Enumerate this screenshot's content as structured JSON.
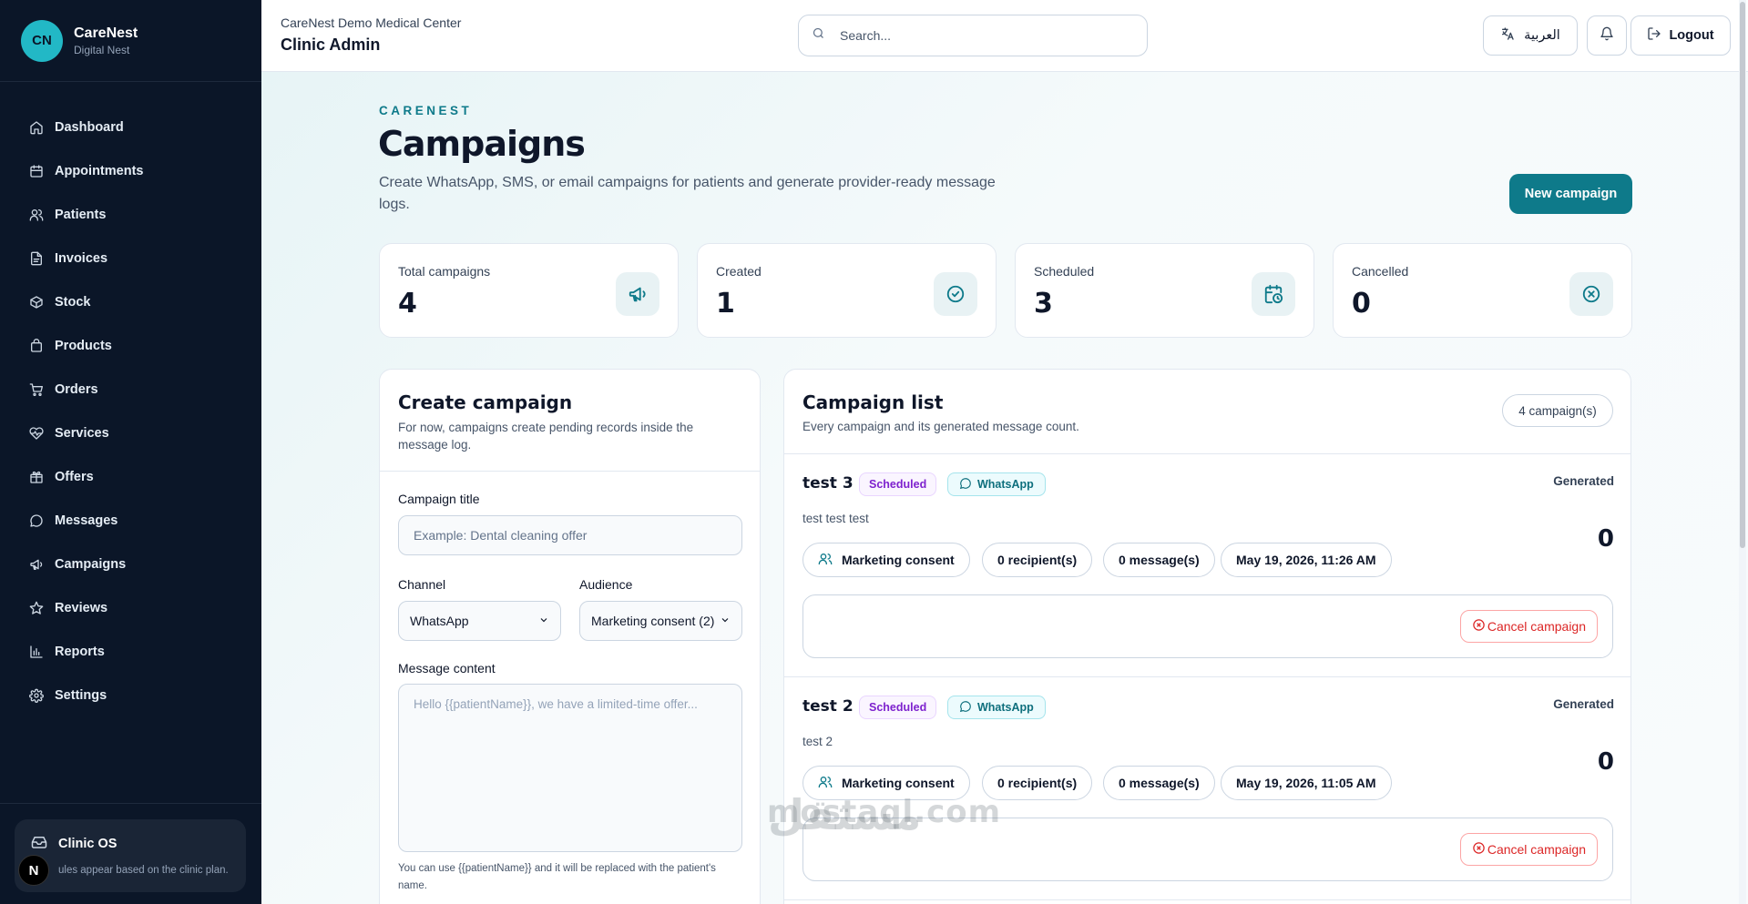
{
  "brand": {
    "initials": "CN",
    "name": "CareNest",
    "sub": "Digital Nest"
  },
  "sidebar": {
    "items": [
      {
        "label": "Dashboard",
        "icon": "home-icon"
      },
      {
        "label": "Appointments",
        "icon": "calendar-icon"
      },
      {
        "label": "Patients",
        "icon": "users-icon"
      },
      {
        "label": "Invoices",
        "icon": "file-icon"
      },
      {
        "label": "Stock",
        "icon": "box-icon"
      },
      {
        "label": "Products",
        "icon": "bag-icon"
      },
      {
        "label": "Orders",
        "icon": "cart-icon"
      },
      {
        "label": "Services",
        "icon": "heart-icon"
      },
      {
        "label": "Offers",
        "icon": "gift-icon"
      },
      {
        "label": "Messages",
        "icon": "chat-icon"
      },
      {
        "label": "Campaigns",
        "icon": "megaphone-icon"
      },
      {
        "label": "Reviews",
        "icon": "star-icon"
      },
      {
        "label": "Reports",
        "icon": "chart-icon"
      },
      {
        "label": "Settings",
        "icon": "gear-icon"
      }
    ],
    "clinic_card": {
      "title": "Clinic OS",
      "text": "ules appear based on the clinic plan."
    },
    "avatar_letter": "N"
  },
  "header": {
    "org": "CareNest Demo Medical Center",
    "role": "Clinic Admin",
    "search_placeholder": "Search...",
    "lang_label": "العربية",
    "logout_label": "Logout"
  },
  "page": {
    "eyebrow": "CARENEST",
    "title": "Campaigns",
    "subtitle": "Create WhatsApp, SMS, or email campaigns for patients and generate provider-ready message logs.",
    "new_button": "New campaign"
  },
  "stats": [
    {
      "label": "Total campaigns",
      "value": "4",
      "icon": "megaphone-icon"
    },
    {
      "label": "Created",
      "value": "1",
      "icon": "check-circle-icon"
    },
    {
      "label": "Scheduled",
      "value": "3",
      "icon": "calendar-clock-icon"
    },
    {
      "label": "Cancelled",
      "value": "0",
      "icon": "x-circle-icon"
    }
  ],
  "create": {
    "title": "Create campaign",
    "desc": "For now, campaigns create pending records inside the message log.",
    "title_label": "Campaign title",
    "title_placeholder": "Example: Dental cleaning offer",
    "channel_label": "Channel",
    "channel_value": "WhatsApp",
    "audience_label": "Audience",
    "audience_value": "Marketing consent (2)",
    "content_label": "Message content",
    "content_placeholder": "Hello {{patientName}}, we have a limited-time offer...",
    "hint": "You can use {{patientName}} and it will be replaced with the patient's name."
  },
  "list": {
    "title": "Campaign list",
    "desc": "Every campaign and its generated message count.",
    "count": "4 campaign(s)",
    "campaigns": [
      {
        "name": "test 3",
        "status": "Scheduled",
        "channel": "WhatsApp",
        "desc": "test test test",
        "generated_label": "Generated",
        "generated": "0",
        "audience": "Marketing consent",
        "recipients": "0 recipient(s)",
        "messages": "0 message(s)",
        "date": "May 19, 2026, 11:26 AM",
        "cancel": "Cancel campaign"
      },
      {
        "name": "test 2",
        "status": "Scheduled",
        "channel": "WhatsApp",
        "desc": "test 2",
        "generated_label": "Generated",
        "generated": "0",
        "audience": "Marketing consent",
        "recipients": "0 recipient(s)",
        "messages": "0 message(s)",
        "date": "May 19, 2026, 11:05 AM",
        "cancel": "Cancel campaign"
      }
    ]
  },
  "watermark": {
    "arabic": "مستقل",
    "latin": "mostaql.com"
  }
}
